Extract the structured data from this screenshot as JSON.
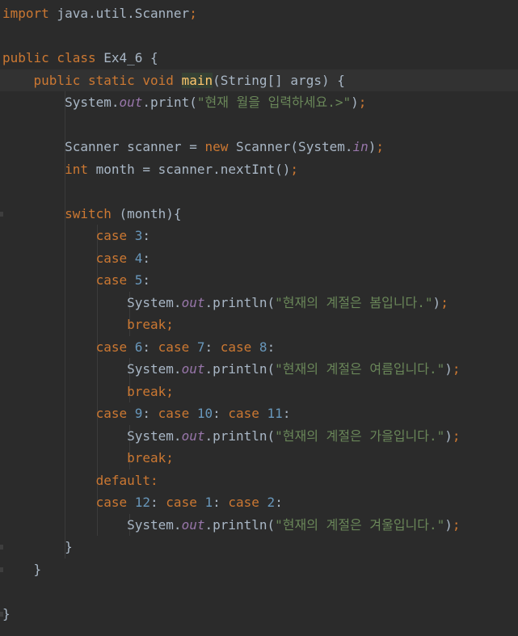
{
  "editor": {
    "lines": [
      [
        {
          "t": "import",
          "c": "kw"
        },
        {
          "t": " java.util.Scanner"
        },
        {
          "t": ";",
          "c": "kw"
        }
      ],
      [],
      [
        {
          "t": "public class",
          "c": "kw"
        },
        {
          "t": " Ex4_6 {"
        }
      ],
      [
        {
          "t": "    "
        },
        {
          "t": "public static void",
          "c": "kw"
        },
        {
          "t": " "
        },
        {
          "t": "main",
          "c": "fn"
        },
        {
          "t": "(String[] args) {"
        }
      ],
      [
        {
          "t": "        System."
        },
        {
          "t": "out",
          "c": "fld"
        },
        {
          "t": ".print("
        },
        {
          "t": "\"현재 월을 입력하세요.>\"",
          "c": "str"
        },
        {
          "t": ")"
        },
        {
          "t": ";",
          "c": "kw"
        }
      ],
      [],
      [
        {
          "t": "        Scanner scanner = "
        },
        {
          "t": "new",
          "c": "kw"
        },
        {
          "t": " Scanner(System."
        },
        {
          "t": "in",
          "c": "fld"
        },
        {
          "t": ")"
        },
        {
          "t": ";",
          "c": "kw"
        }
      ],
      [
        {
          "t": "        "
        },
        {
          "t": "int",
          "c": "kw"
        },
        {
          "t": " month = scanner.nextInt()"
        },
        {
          "t": ";",
          "c": "kw"
        }
      ],
      [],
      [
        {
          "t": "        "
        },
        {
          "t": "switch",
          "c": "kw"
        },
        {
          "t": " (month){"
        }
      ],
      [
        {
          "t": "            "
        },
        {
          "t": "case",
          "c": "kw"
        },
        {
          "t": " "
        },
        {
          "t": "3",
          "c": "num"
        },
        {
          "t": ":"
        }
      ],
      [
        {
          "t": "            "
        },
        {
          "t": "case",
          "c": "kw"
        },
        {
          "t": " "
        },
        {
          "t": "4",
          "c": "num"
        },
        {
          "t": ":"
        }
      ],
      [
        {
          "t": "            "
        },
        {
          "t": "case",
          "c": "kw"
        },
        {
          "t": " "
        },
        {
          "t": "5",
          "c": "num"
        },
        {
          "t": ":"
        }
      ],
      [
        {
          "t": "                System."
        },
        {
          "t": "out",
          "c": "fld"
        },
        {
          "t": ".println("
        },
        {
          "t": "\"현재의 계절은 봄입니다.\"",
          "c": "str"
        },
        {
          "t": ")"
        },
        {
          "t": ";",
          "c": "kw"
        }
      ],
      [
        {
          "t": "                "
        },
        {
          "t": "break;",
          "c": "kw"
        }
      ],
      [
        {
          "t": "            "
        },
        {
          "t": "case",
          "c": "kw"
        },
        {
          "t": " "
        },
        {
          "t": "6",
          "c": "num"
        },
        {
          "t": ": "
        },
        {
          "t": "case",
          "c": "kw"
        },
        {
          "t": " "
        },
        {
          "t": "7",
          "c": "num"
        },
        {
          "t": ": "
        },
        {
          "t": "case",
          "c": "kw"
        },
        {
          "t": " "
        },
        {
          "t": "8",
          "c": "num"
        },
        {
          "t": ":"
        }
      ],
      [
        {
          "t": "                System."
        },
        {
          "t": "out",
          "c": "fld"
        },
        {
          "t": ".println("
        },
        {
          "t": "\"현재의 계절은 여름입니다.\"",
          "c": "str"
        },
        {
          "t": ")"
        },
        {
          "t": ";",
          "c": "kw"
        }
      ],
      [
        {
          "t": "                "
        },
        {
          "t": "break;",
          "c": "kw"
        }
      ],
      [
        {
          "t": "            "
        },
        {
          "t": "case",
          "c": "kw"
        },
        {
          "t": " "
        },
        {
          "t": "9",
          "c": "num"
        },
        {
          "t": ": "
        },
        {
          "t": "case",
          "c": "kw"
        },
        {
          "t": " "
        },
        {
          "t": "10",
          "c": "num"
        },
        {
          "t": ": "
        },
        {
          "t": "case",
          "c": "kw"
        },
        {
          "t": " "
        },
        {
          "t": "11",
          "c": "num"
        },
        {
          "t": ":"
        }
      ],
      [
        {
          "t": "                System."
        },
        {
          "t": "out",
          "c": "fld"
        },
        {
          "t": ".println("
        },
        {
          "t": "\"현재의 계절은 가을입니다.\"",
          "c": "str"
        },
        {
          "t": ")"
        },
        {
          "t": ";",
          "c": "kw"
        }
      ],
      [
        {
          "t": "                "
        },
        {
          "t": "break;",
          "c": "kw"
        }
      ],
      [
        {
          "t": "            "
        },
        {
          "t": "default:",
          "c": "kw"
        }
      ],
      [
        {
          "t": "            "
        },
        {
          "t": "case",
          "c": "kw"
        },
        {
          "t": " "
        },
        {
          "t": "12",
          "c": "num"
        },
        {
          "t": ": "
        },
        {
          "t": "case",
          "c": "kw"
        },
        {
          "t": " "
        },
        {
          "t": "1",
          "c": "num"
        },
        {
          "t": ": "
        },
        {
          "t": "case",
          "c": "kw"
        },
        {
          "t": " "
        },
        {
          "t": "2",
          "c": "num"
        },
        {
          "t": ":"
        }
      ],
      [
        {
          "t": "                System."
        },
        {
          "t": "out",
          "c": "fld"
        },
        {
          "t": ".println("
        },
        {
          "t": "\"현재의 계절은 겨울입니다.\"",
          "c": "str"
        },
        {
          "t": ")"
        },
        {
          "t": ";",
          "c": "kw"
        }
      ],
      [
        {
          "t": "        }"
        }
      ],
      [
        {
          "t": "    }"
        }
      ],
      [],
      [
        {
          "t": "}"
        }
      ]
    ],
    "current_line": 3,
    "highlighted_token": "main"
  },
  "theme": {
    "background": "#2b2b2b",
    "current_line_background": "#323232",
    "text": "#a9b7c6",
    "keyword": "#cc7832",
    "number": "#6897bb",
    "string": "#6a8759",
    "static_field": "#9876aa",
    "method_declaration": "#ffc66d"
  }
}
